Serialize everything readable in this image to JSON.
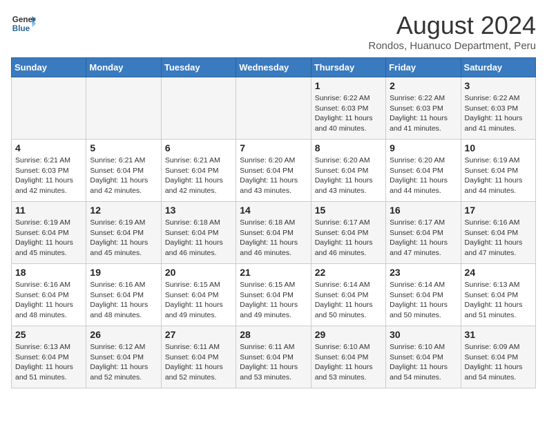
{
  "header": {
    "logo_line1": "General",
    "logo_line2": "Blue",
    "month_year": "August 2024",
    "location": "Rondos, Huanuco Department, Peru"
  },
  "days_of_week": [
    "Sunday",
    "Monday",
    "Tuesday",
    "Wednesday",
    "Thursday",
    "Friday",
    "Saturday"
  ],
  "weeks": [
    [
      {
        "day": "",
        "info": ""
      },
      {
        "day": "",
        "info": ""
      },
      {
        "day": "",
        "info": ""
      },
      {
        "day": "",
        "info": ""
      },
      {
        "day": "1",
        "info": "Sunrise: 6:22 AM\nSunset: 6:03 PM\nDaylight: 11 hours\nand 40 minutes."
      },
      {
        "day": "2",
        "info": "Sunrise: 6:22 AM\nSunset: 6:03 PM\nDaylight: 11 hours\nand 41 minutes."
      },
      {
        "day": "3",
        "info": "Sunrise: 6:22 AM\nSunset: 6:03 PM\nDaylight: 11 hours\nand 41 minutes."
      }
    ],
    [
      {
        "day": "4",
        "info": "Sunrise: 6:21 AM\nSunset: 6:03 PM\nDaylight: 11 hours\nand 42 minutes."
      },
      {
        "day": "5",
        "info": "Sunrise: 6:21 AM\nSunset: 6:04 PM\nDaylight: 11 hours\nand 42 minutes."
      },
      {
        "day": "6",
        "info": "Sunrise: 6:21 AM\nSunset: 6:04 PM\nDaylight: 11 hours\nand 42 minutes."
      },
      {
        "day": "7",
        "info": "Sunrise: 6:20 AM\nSunset: 6:04 PM\nDaylight: 11 hours\nand 43 minutes."
      },
      {
        "day": "8",
        "info": "Sunrise: 6:20 AM\nSunset: 6:04 PM\nDaylight: 11 hours\nand 43 minutes."
      },
      {
        "day": "9",
        "info": "Sunrise: 6:20 AM\nSunset: 6:04 PM\nDaylight: 11 hours\nand 44 minutes."
      },
      {
        "day": "10",
        "info": "Sunrise: 6:19 AM\nSunset: 6:04 PM\nDaylight: 11 hours\nand 44 minutes."
      }
    ],
    [
      {
        "day": "11",
        "info": "Sunrise: 6:19 AM\nSunset: 6:04 PM\nDaylight: 11 hours\nand 45 minutes."
      },
      {
        "day": "12",
        "info": "Sunrise: 6:19 AM\nSunset: 6:04 PM\nDaylight: 11 hours\nand 45 minutes."
      },
      {
        "day": "13",
        "info": "Sunrise: 6:18 AM\nSunset: 6:04 PM\nDaylight: 11 hours\nand 46 minutes."
      },
      {
        "day": "14",
        "info": "Sunrise: 6:18 AM\nSunset: 6:04 PM\nDaylight: 11 hours\nand 46 minutes."
      },
      {
        "day": "15",
        "info": "Sunrise: 6:17 AM\nSunset: 6:04 PM\nDaylight: 11 hours\nand 46 minutes."
      },
      {
        "day": "16",
        "info": "Sunrise: 6:17 AM\nSunset: 6:04 PM\nDaylight: 11 hours\nand 47 minutes."
      },
      {
        "day": "17",
        "info": "Sunrise: 6:16 AM\nSunset: 6:04 PM\nDaylight: 11 hours\nand 47 minutes."
      }
    ],
    [
      {
        "day": "18",
        "info": "Sunrise: 6:16 AM\nSunset: 6:04 PM\nDaylight: 11 hours\nand 48 minutes."
      },
      {
        "day": "19",
        "info": "Sunrise: 6:16 AM\nSunset: 6:04 PM\nDaylight: 11 hours\nand 48 minutes."
      },
      {
        "day": "20",
        "info": "Sunrise: 6:15 AM\nSunset: 6:04 PM\nDaylight: 11 hours\nand 49 minutes."
      },
      {
        "day": "21",
        "info": "Sunrise: 6:15 AM\nSunset: 6:04 PM\nDaylight: 11 hours\nand 49 minutes."
      },
      {
        "day": "22",
        "info": "Sunrise: 6:14 AM\nSunset: 6:04 PM\nDaylight: 11 hours\nand 50 minutes."
      },
      {
        "day": "23",
        "info": "Sunrise: 6:14 AM\nSunset: 6:04 PM\nDaylight: 11 hours\nand 50 minutes."
      },
      {
        "day": "24",
        "info": "Sunrise: 6:13 AM\nSunset: 6:04 PM\nDaylight: 11 hours\nand 51 minutes."
      }
    ],
    [
      {
        "day": "25",
        "info": "Sunrise: 6:13 AM\nSunset: 6:04 PM\nDaylight: 11 hours\nand 51 minutes."
      },
      {
        "day": "26",
        "info": "Sunrise: 6:12 AM\nSunset: 6:04 PM\nDaylight: 11 hours\nand 52 minutes."
      },
      {
        "day": "27",
        "info": "Sunrise: 6:11 AM\nSunset: 6:04 PM\nDaylight: 11 hours\nand 52 minutes."
      },
      {
        "day": "28",
        "info": "Sunrise: 6:11 AM\nSunset: 6:04 PM\nDaylight: 11 hours\nand 53 minutes."
      },
      {
        "day": "29",
        "info": "Sunrise: 6:10 AM\nSunset: 6:04 PM\nDaylight: 11 hours\nand 53 minutes."
      },
      {
        "day": "30",
        "info": "Sunrise: 6:10 AM\nSunset: 6:04 PM\nDaylight: 11 hours\nand 54 minutes."
      },
      {
        "day": "31",
        "info": "Sunrise: 6:09 AM\nSunset: 6:04 PM\nDaylight: 11 hours\nand 54 minutes."
      }
    ]
  ]
}
